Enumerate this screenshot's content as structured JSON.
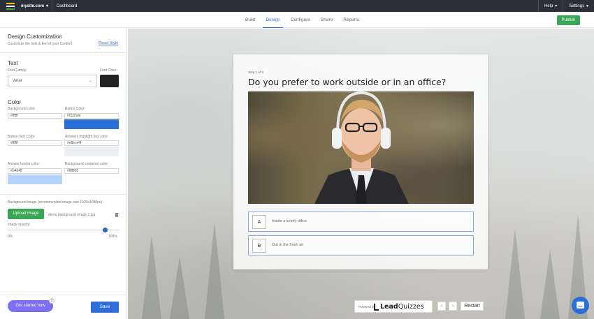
{
  "topbar": {
    "site_label": "mysite.com",
    "dashboard_label": "Dashboard",
    "help_label": "Help",
    "settings_label": "Settings"
  },
  "nav": {
    "tabs": [
      {
        "label": "Build"
      },
      {
        "label": "Design"
      },
      {
        "label": "Configure"
      },
      {
        "label": "Share"
      },
      {
        "label": "Reports"
      }
    ],
    "active_tab": "Design",
    "publish_label": "Publish"
  },
  "panel": {
    "title": "Design Customization",
    "subtitle": "Customize the look & feel of your Content",
    "reset_label": "Reset Style",
    "text_section": {
      "heading": "Text",
      "font_family_label": "Font Family:",
      "font_family_value": "Arial",
      "font_color_label": "Font Color:",
      "font_color": "#222222"
    },
    "color_section": {
      "heading": "Color",
      "background_color_label": "Background color:",
      "background_color_value": "#ffffff",
      "button_color_label": "Button Color:",
      "button_color_value": "#0155de",
      "button_color_swatch": "#2a6ed8",
      "button_text_color_label": "Button Text Color:",
      "button_text_color_value": "#ffffff",
      "answers_highlight_label": "Answers highlight box color:",
      "answers_highlight_value": "#e8ecef4",
      "answers_highlight_swatch": "#eceff1",
      "answer_border_label": "Answer border color:",
      "answer_border_value": "#b4d4ff",
      "answer_border_swatch": "#b4d4ff",
      "background_container_label": "Background container color:",
      "background_container_value": "#ffffff00"
    },
    "image_section": {
      "background_image_label": "Background image (recommended image size 1920x1080px)",
      "upload_label": "Upload image",
      "file_name": "demo background image 2.jpg",
      "opacity_label": "Image opacity:",
      "opacity_value": 0.9,
      "min_label": "0%",
      "max_label": "100%"
    },
    "get_started_label": "Get started now",
    "get_started_badge": "3",
    "save_label": "Save"
  },
  "preview": {
    "step_label": "Step 1 of 3",
    "question": "Do you prefer to work outside or in an office?",
    "answers": [
      {
        "letter": "A",
        "text": "Inside a comfy office"
      },
      {
        "letter": "B",
        "text": "Out in the fresh air"
      }
    ],
    "powered_by_label": "Powered by",
    "brand_lead": "Lead",
    "brand_quizzes": "Quizzes",
    "prev_icon": "‹",
    "next_icon": "›",
    "restart_label": "Restart"
  },
  "colors": {
    "accent_blue": "#3a6fd8",
    "publish_green": "#3aa757",
    "topbar": "#2b2f38"
  }
}
